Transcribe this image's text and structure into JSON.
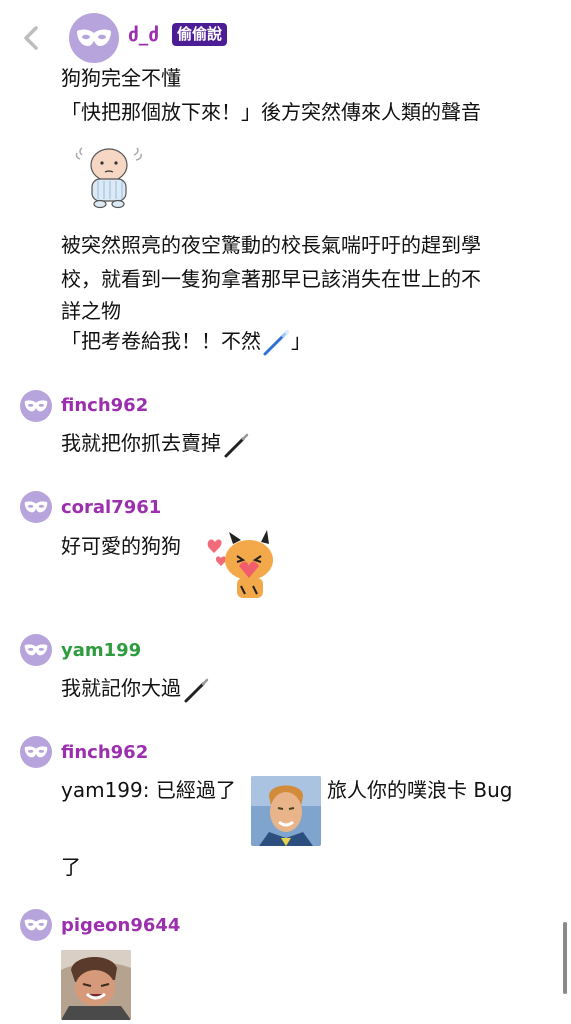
{
  "post": {
    "author": "ძ_ძ",
    "badge": "偷偷說",
    "lines": [
      "狗狗完全不懂",
      "「快把那個放下來！」後方突然傳來人類的聲音",
      "被突然照亮的夜空驚動的校長氣喘吁吁的趕到學",
      "校，就看到一隻狗拿著那早已該消失在世上的不",
      "詳之物",
      "「把考卷給我！！不然",
      "」"
    ]
  },
  "comments": [
    {
      "name": "finch962",
      "text": "我就把你抓去賣掉"
    },
    {
      "name": "coral7961",
      "text": "好可愛的狗狗"
    },
    {
      "name": "yam199",
      "text": "我就記你大過"
    },
    {
      "name": "finch962",
      "text_before": "yam199: 已經過了",
      "text_after": "旅人你的噗浪卡 Bug",
      "text_wrap": "了"
    },
    {
      "name": "pigeon9644"
    }
  ],
  "colors": {
    "name_purple": "#9b2fae",
    "name_green": "#2e9b3e",
    "avatar": "#b7a4dc",
    "badge_bg": "#4c1d95"
  }
}
